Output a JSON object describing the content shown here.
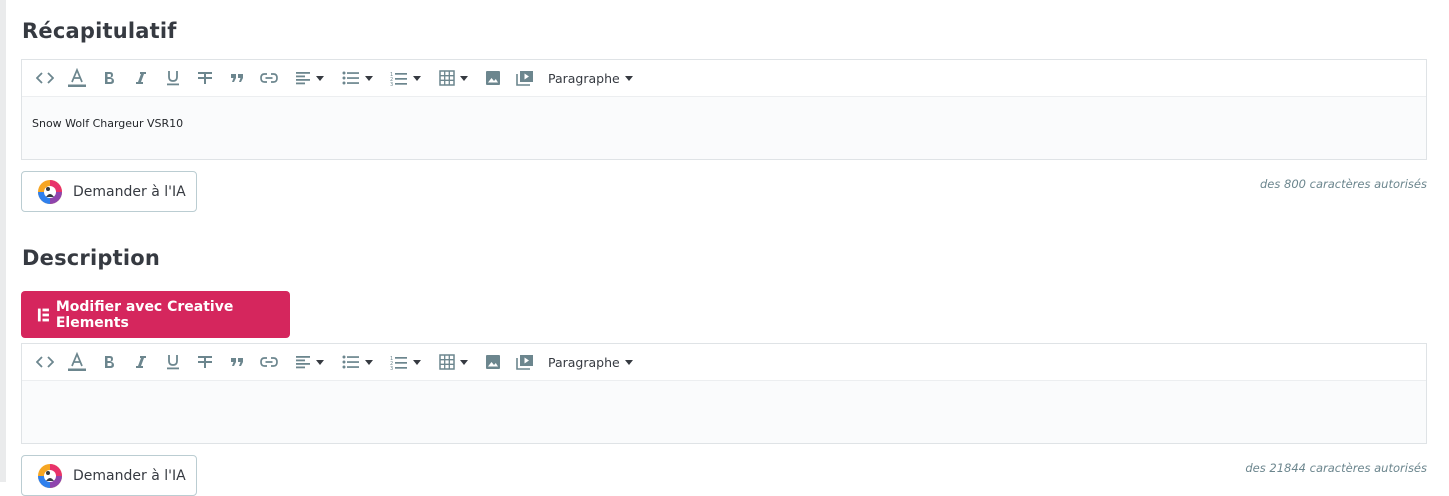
{
  "summary": {
    "title": "Récapitulatif",
    "content": "Snow Wolf Chargeur VSR10",
    "counter": "des 800 caractères autorisés",
    "ai_button": "Demander à l'IA"
  },
  "description": {
    "title": "Description",
    "creative_button": "Modifier avec Creative Elements",
    "content": "",
    "counter": "des 21844 caractères autorisés",
    "ai_button": "Demander à l'IA"
  },
  "toolbar": {
    "format_label": "Paragraphe",
    "icons": [
      "code-view-icon",
      "font-color-icon",
      "bold-icon",
      "italic-icon",
      "underline-icon",
      "strikethrough-icon",
      "blockquote-icon",
      "link-icon",
      "align-icon",
      "bullet-list-icon",
      "numbered-list-icon",
      "table-icon",
      "image-icon",
      "video-icon"
    ]
  },
  "colors": {
    "accent": "#d5265d",
    "toolbar_icon": "#6c868e",
    "border": "#dfe3e6"
  }
}
